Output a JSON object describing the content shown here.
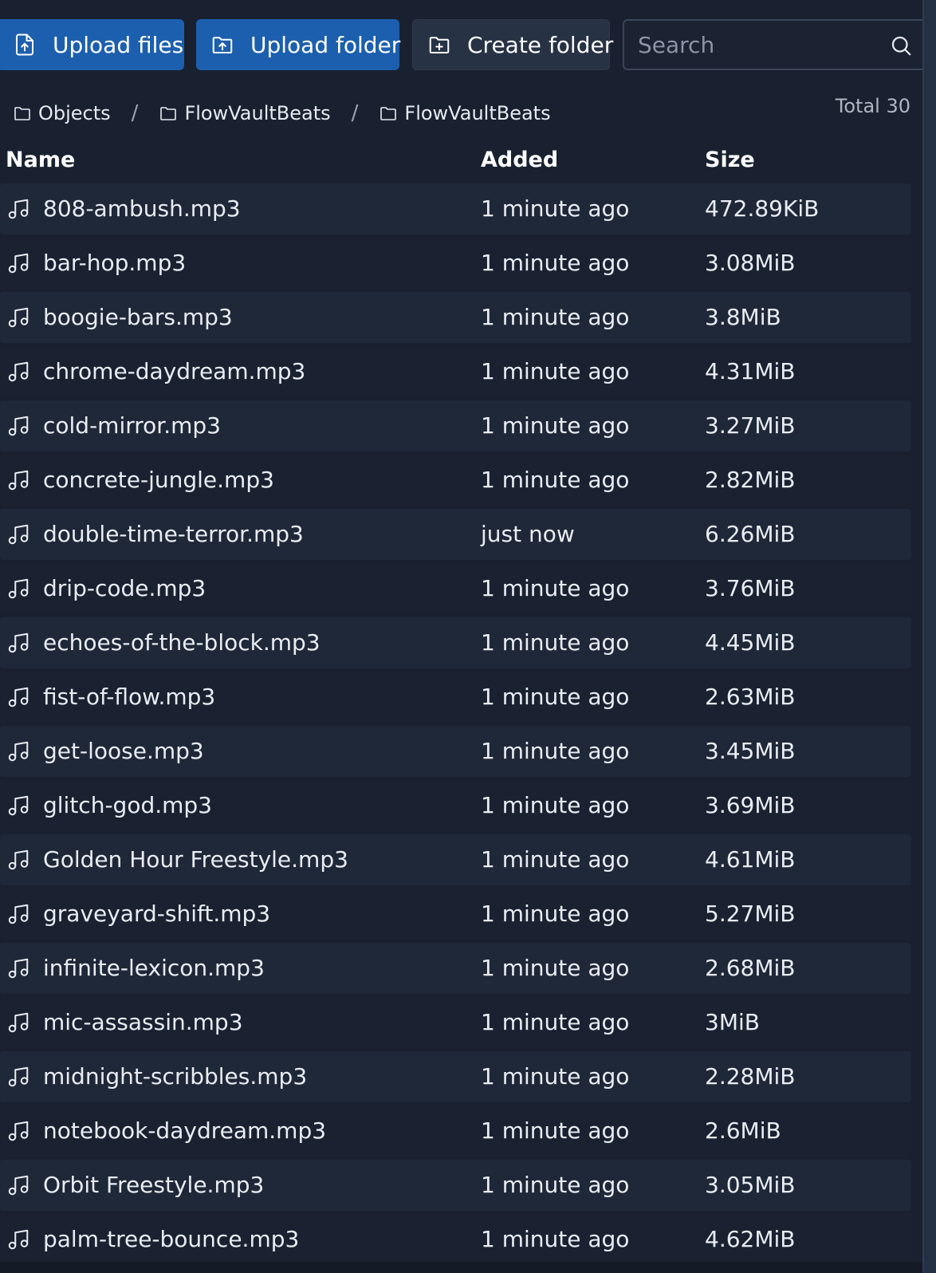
{
  "toolbar": {
    "upload_files_label": "Upload files",
    "upload_folder_label": "Upload folder",
    "create_folder_label": "Create folder",
    "search_placeholder": "Search"
  },
  "breadcrumb": {
    "items": [
      "Objects",
      "FlowVaultBeats",
      "FlowVaultBeats"
    ],
    "separator": "/"
  },
  "total_label": "Total 30",
  "table": {
    "columns": [
      "Name",
      "Added",
      "Size"
    ],
    "rows": [
      {
        "name": "808-ambush.mp3",
        "added": "1 minute ago",
        "size": "472.89KiB"
      },
      {
        "name": "bar-hop.mp3",
        "added": "1 minute ago",
        "size": "3.08MiB"
      },
      {
        "name": "boogie-bars.mp3",
        "added": "1 minute ago",
        "size": "3.8MiB"
      },
      {
        "name": "chrome-daydream.mp3",
        "added": "1 minute ago",
        "size": "4.31MiB"
      },
      {
        "name": "cold-mirror.mp3",
        "added": "1 minute ago",
        "size": "3.27MiB"
      },
      {
        "name": "concrete-jungle.mp3",
        "added": "1 minute ago",
        "size": "2.82MiB"
      },
      {
        "name": "double-time-terror.mp3",
        "added": "just now",
        "size": "6.26MiB"
      },
      {
        "name": "drip-code.mp3",
        "added": "1 minute ago",
        "size": "3.76MiB"
      },
      {
        "name": "echoes-of-the-block.mp3",
        "added": "1 minute ago",
        "size": "4.45MiB"
      },
      {
        "name": "fist-of-flow.mp3",
        "added": "1 minute ago",
        "size": "2.63MiB"
      },
      {
        "name": "get-loose.mp3",
        "added": "1 minute ago",
        "size": "3.45MiB"
      },
      {
        "name": "glitch-god.mp3",
        "added": "1 minute ago",
        "size": "3.69MiB"
      },
      {
        "name": "Golden Hour Freestyle.mp3",
        "added": "1 minute ago",
        "size": "4.61MiB"
      },
      {
        "name": "graveyard-shift.mp3",
        "added": "1 minute ago",
        "size": "5.27MiB"
      },
      {
        "name": "infinite-lexicon.mp3",
        "added": "1 minute ago",
        "size": "2.68MiB"
      },
      {
        "name": "mic-assassin.mp3",
        "added": "1 minute ago",
        "size": "3MiB"
      },
      {
        "name": "midnight-scribbles.mp3",
        "added": "1 minute ago",
        "size": "2.28MiB"
      },
      {
        "name": "notebook-daydream.mp3",
        "added": "1 minute ago",
        "size": "2.6MiB"
      },
      {
        "name": "Orbit Freestyle.mp3",
        "added": "1 minute ago",
        "size": "3.05MiB"
      },
      {
        "name": "palm-tree-bounce.mp3",
        "added": "1 minute ago",
        "size": "4.62MiB"
      }
    ]
  },
  "icons": {
    "upload_files": "file-upload-icon",
    "upload_folder": "folder-upload-icon",
    "create_folder": "folder-plus-icon",
    "search": "search-icon",
    "breadcrumb": "folder-icon",
    "row": "music-note-icon"
  },
  "colors": {
    "background": "#192130",
    "primary_button": "#1c5fae",
    "secondary_button": "#273245",
    "row": "#1f2838",
    "row_alt": "#1a2231"
  }
}
